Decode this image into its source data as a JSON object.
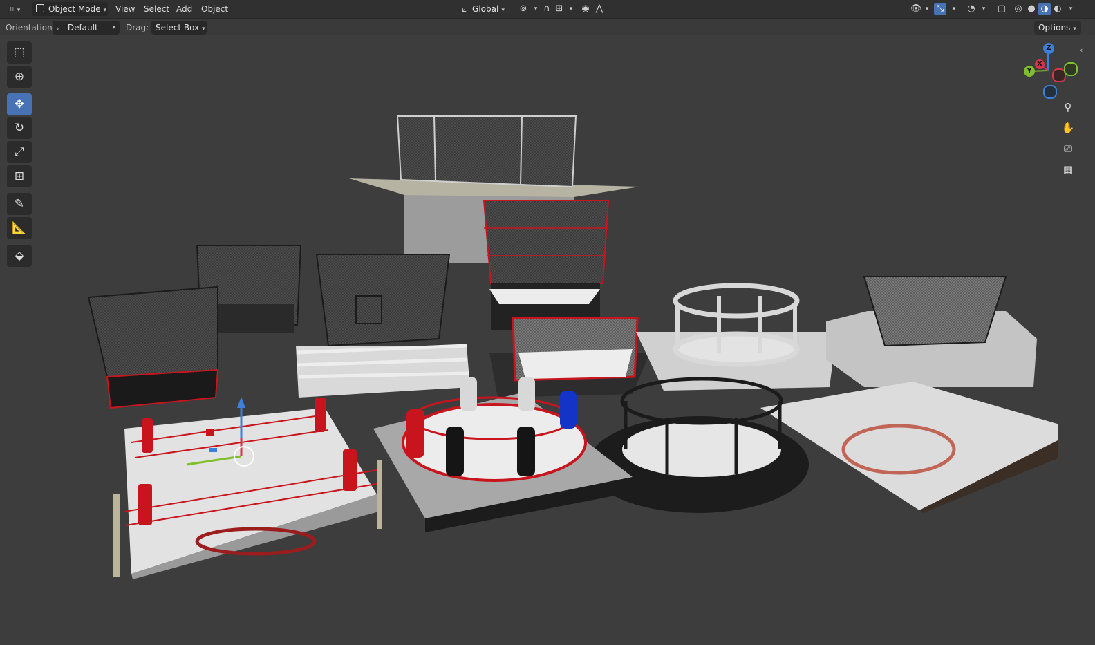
{
  "header": {
    "editor_type_icon": "axes-editor-icon",
    "mode_label": "Object Mode",
    "menus": [
      "View",
      "Select",
      "Add",
      "Object"
    ],
    "transform_orientation": "Global",
    "pivot_icon": "pivot-icon",
    "snap_icon": "snap-magnet-icon",
    "proportional_icon": "proportional-edit-icon",
    "right_icons": [
      "visibility-icon",
      "gizmo-icon",
      "overlay-icon",
      "xray-icon",
      "wireframe-shading-icon",
      "solid-shading-icon",
      "material-shading-icon",
      "rendered-shading-icon"
    ]
  },
  "tool_header": {
    "orientation_label": "Orientation:",
    "orientation_value": "Default",
    "drag_label": "Drag:",
    "drag_value": "Select Box",
    "options_label": "Options"
  },
  "toolbar": {
    "tools": [
      {
        "name": "select-box-tool",
        "icon": "⬚"
      },
      {
        "name": "cursor-tool",
        "icon": "⊕"
      },
      {
        "name": "move-tool",
        "icon": "✥"
      },
      {
        "name": "rotate-tool",
        "icon": "↻"
      },
      {
        "name": "scale-tool",
        "icon": "⤢"
      },
      {
        "name": "transform-tool",
        "icon": "⊞"
      },
      {
        "name": "annotate-tool",
        "icon": "✎"
      },
      {
        "name": "measure-tool",
        "icon": "📐"
      },
      {
        "name": "add-cube-tool",
        "icon": "⬙"
      }
    ],
    "active_tool": "move-tool"
  },
  "gizmo": {
    "z": "Z",
    "x": "X",
    "y": "Y"
  },
  "nav_buttons": [
    "zoom-icon",
    "pan-hand-icon",
    "camera-view-icon",
    "ortho-grid-icon"
  ],
  "colors": {
    "accent": "#4772b3",
    "x_axis": "#d6344a",
    "y_axis": "#7fbf2b",
    "z_axis": "#3d80d9",
    "ring_red": "#c8151d"
  }
}
